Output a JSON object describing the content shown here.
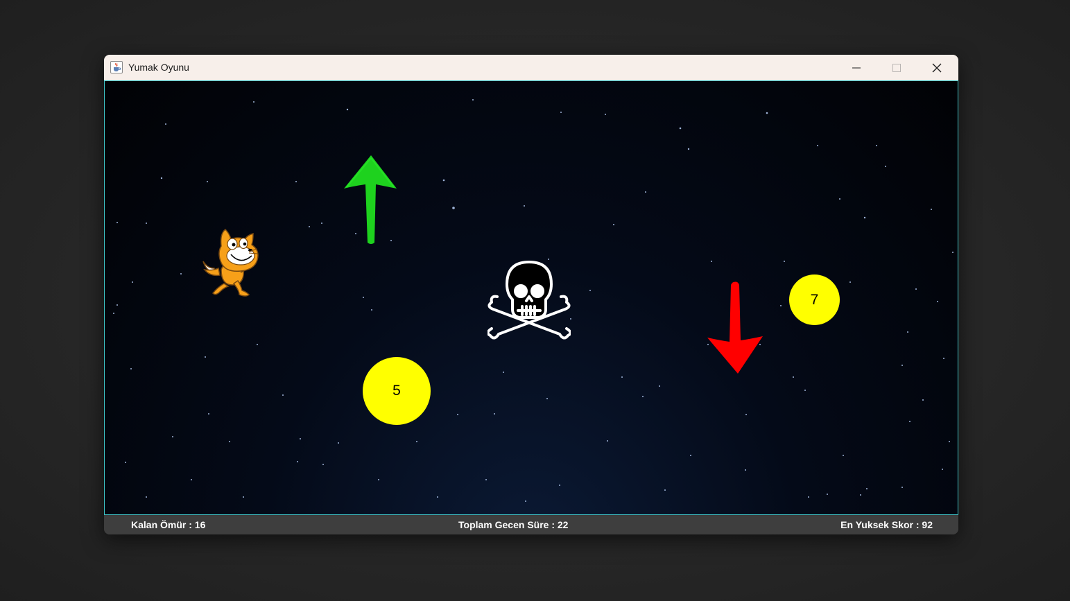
{
  "window": {
    "title": "Yumak Oyunu",
    "icon": "java-cup-icon",
    "controls": [
      "minimize-icon",
      "maximize-icon",
      "close-icon"
    ]
  },
  "game": {
    "player": {
      "icon": "cat-sprite"
    },
    "items": [
      {
        "icon": "green-up-arrow-icon",
        "color": "#1ed21e"
      },
      {
        "icon": "red-down-arrow-icon",
        "color": "#ff0000"
      },
      {
        "icon": "skull-crossbones-icon",
        "color": "#ffffff"
      }
    ],
    "balls": [
      {
        "value": "5",
        "color": "#ffff00"
      },
      {
        "value": "7",
        "color": "#ffff00"
      }
    ]
  },
  "status": {
    "lives": "Kalan Ömür : 16",
    "elapsed": "Toplam Gecen Süre : 22",
    "high_score": "En Yuksek Skor : 92"
  },
  "colors": {
    "border_accent": "#3fc5c8",
    "status_bg": "#3e3e3e",
    "titlebar_bg": "#f7efea"
  }
}
